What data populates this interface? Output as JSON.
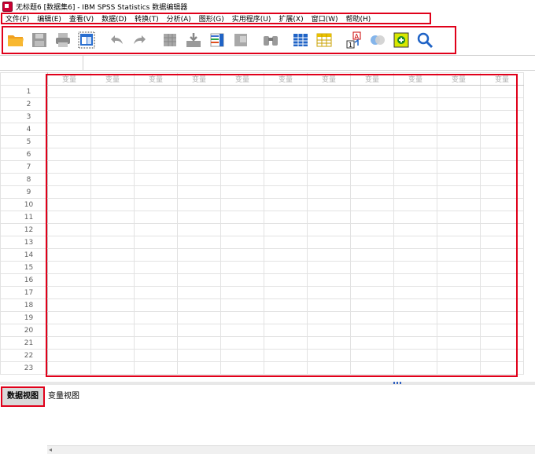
{
  "window": {
    "title": "无标题6 [数据集6] - IBM SPSS Statistics 数据编辑器"
  },
  "menu": [
    "文件(F)",
    "编辑(E)",
    "查看(V)",
    "数据(D)",
    "转换(T)",
    "分析(A)",
    "图形(G)",
    "实用程序(U)",
    "扩展(X)",
    "窗口(W)",
    "帮助(H)"
  ],
  "toolbar": [
    {
      "name": "open-icon"
    },
    {
      "name": "save-icon"
    },
    {
      "name": "print-icon"
    },
    {
      "name": "recall-dialog-icon"
    },
    {
      "name": "undo-icon"
    },
    {
      "name": "redo-icon"
    },
    {
      "name": "goto-case-icon"
    },
    {
      "name": "goto-variable-icon"
    },
    {
      "name": "variables-icon"
    },
    {
      "name": "run-descriptives-icon"
    },
    {
      "name": "find-icon"
    },
    {
      "name": "insert-cases-icon"
    },
    {
      "name": "insert-variable-icon"
    },
    {
      "name": "split-file-icon"
    },
    {
      "name": "value-labels-icon"
    },
    {
      "name": "use-sets-icon"
    },
    {
      "name": "spell-check-icon"
    }
  ],
  "grid": {
    "column_header": "变量",
    "column_count": 11,
    "rows": [
      "1",
      "2",
      "3",
      "4",
      "5",
      "6",
      "7",
      "8",
      "9",
      "10",
      "11",
      "12",
      "13",
      "14",
      "15",
      "16",
      "17",
      "18",
      "19",
      "20",
      "21",
      "22",
      "23"
    ]
  },
  "tabs": {
    "data_view": "数据视图",
    "variable_view": "变量视图"
  },
  "colors": {
    "highlight": "#e0001a",
    "accent_blue": "#1f63c6"
  }
}
